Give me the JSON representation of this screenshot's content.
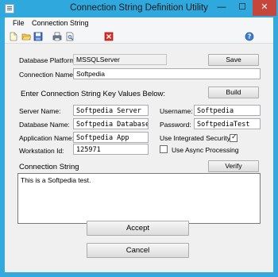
{
  "window": {
    "title": "Connection String Definition Utility",
    "minimize_glyph": "—",
    "maximize_glyph": "☐",
    "close_glyph": "✕"
  },
  "menu": {
    "file": "File",
    "connection_string": "Connection String"
  },
  "toolbar": {
    "icons": [
      "new-icon",
      "open-icon",
      "save-icon",
      "print-icon",
      "print-preview-icon",
      "close-document-icon",
      "help-icon"
    ]
  },
  "form": {
    "database_platform": {
      "label": "Database Platform",
      "value": "MSSQLServer"
    },
    "connection_name": {
      "label": "Connection Name",
      "value": "Softpedia"
    },
    "save_button": "Save",
    "instructions": "Enter Connection String Key Values Below:",
    "build_button": "Build",
    "server_name": {
      "label": "Server Name:",
      "value": "Softpedia Server"
    },
    "database_name": {
      "label": "Database Name:",
      "value": "Softpedia Database"
    },
    "application_name": {
      "label": "Application Name:",
      "value": "Softpedia App"
    },
    "workstation_id": {
      "label": "Workstation Id:",
      "value": "125971"
    },
    "username": {
      "label": "Username:",
      "value": "Softpedia"
    },
    "password": {
      "label": "Password:",
      "value": "SoftpediaTest"
    },
    "integrated_security": {
      "label": "Use Integrated Security:",
      "checked": true,
      "mark": "✓"
    },
    "async_processing": {
      "label": "Use Async Processing",
      "checked": false
    },
    "connection_string": {
      "label": "Connection String",
      "value": "This is a Softpedia test."
    },
    "verify_button": "Verify",
    "accept_button": "Accept",
    "cancel_button": "Cancel"
  },
  "colors": {
    "titlebar": "#2ea8dd",
    "close_button": "#c7463b",
    "dialog_bg": "#f0f0f0"
  }
}
